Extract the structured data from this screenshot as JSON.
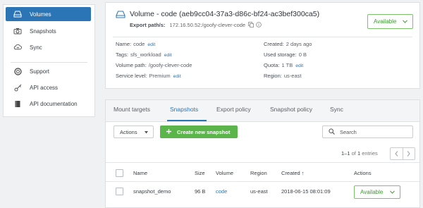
{
  "sidebar": {
    "items": [
      {
        "label": "Volumes",
        "icon": "volume-drive-icon",
        "active": true
      },
      {
        "label": "Snapshots",
        "icon": "camera-icon",
        "active": false
      },
      {
        "label": "Sync",
        "icon": "cloud-sync-icon",
        "active": false
      },
      {
        "label": "Support",
        "icon": "lifebuoy-icon",
        "active": false
      },
      {
        "label": "API access",
        "icon": "key-icon",
        "active": false
      },
      {
        "label": "API documentation",
        "icon": "book-icon",
        "active": false
      }
    ]
  },
  "volume": {
    "title": "Volume - code (aeb9cc04-37a3-d86c-bf24-ac3bef300ca5)",
    "export_label": "Export path/s:",
    "export_value": "172.16.50.52:/goofy-clever-code",
    "status": "Available",
    "props_left": [
      {
        "label": "Name:",
        "value": "code",
        "edit": "edit"
      },
      {
        "label": "Tags:",
        "value": "sfs_workload",
        "edit": "edit"
      },
      {
        "label": "Volume path:",
        "value": "/goofy-clever-code",
        "edit": ""
      },
      {
        "label": "Service level:",
        "value": "Premium",
        "edit": "edit"
      }
    ],
    "props_right": [
      {
        "label": "Created:",
        "value": "2 days ago",
        "edit": ""
      },
      {
        "label": "Used storage:",
        "value": "0 B",
        "edit": ""
      },
      {
        "label": "Quota:",
        "value": "1 TB",
        "edit": "edit"
      },
      {
        "label": "Region:",
        "value": "us-east",
        "edit": ""
      }
    ]
  },
  "tabs": [
    "Mount targets",
    "Snapshots",
    "Export policy",
    "Snapshot policy",
    "Sync"
  ],
  "active_tab": "Snapshots",
  "toolbar": {
    "actions_label": "Actions",
    "create_label": "Create new snapshot",
    "search_placeholder": "Search"
  },
  "pagination": {
    "range": "1–1",
    "of": "of",
    "total": "1",
    "suffix": "entries"
  },
  "table": {
    "headers": [
      "Name",
      "Size",
      "Volume",
      "Region",
      "Created ↑",
      "Actions"
    ],
    "rows": [
      {
        "name": "snapshot_demo",
        "size": "96 B",
        "volume": "code",
        "region": "us-east",
        "created": "2018-06-15 08:01:09",
        "status": "Available"
      }
    ]
  },
  "colors": {
    "accent": "#2b74b6",
    "success": "#5cb54a",
    "status_border": "#7cc26a",
    "background": "#eff1f2"
  }
}
